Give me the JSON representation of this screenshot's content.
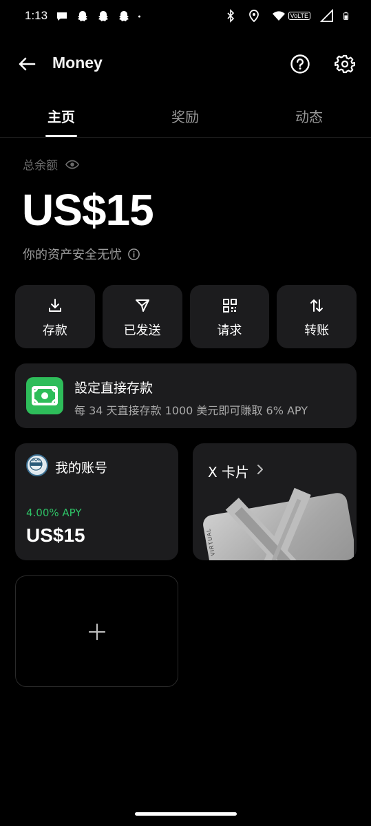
{
  "status_bar": {
    "time": "1:13",
    "left_icons": [
      "chat-icon",
      "snapchat-icon",
      "snapchat-icon",
      "snapchat-icon",
      "dot-icon"
    ],
    "right_icons": [
      "bluetooth-icon",
      "location-icon",
      "wifi-icon",
      "volte-icon",
      "signal-icon",
      "battery-icon"
    ],
    "volte_text": "VoLTE"
  },
  "header": {
    "title": "Money",
    "back_icon": "arrow-left-icon",
    "help_icon": "help-circle-icon",
    "settings_icon": "gear-icon"
  },
  "tabs": [
    {
      "label": "主页",
      "active": true
    },
    {
      "label": "奖励",
      "active": false
    },
    {
      "label": "动态",
      "active": false
    }
  ],
  "balance": {
    "label": "总余额",
    "amount": "US$15",
    "safe_text": "你的资产安全无忧",
    "eye_icon": "eye-icon",
    "info_icon": "info-icon"
  },
  "actions": [
    {
      "label": "存款",
      "icon": "download-icon"
    },
    {
      "label": "已发送",
      "icon": "send-icon"
    },
    {
      "label": "请求",
      "icon": "qr-code-icon"
    },
    {
      "label": "转账",
      "icon": "transfer-arrows-icon"
    }
  ],
  "promo": {
    "title": "設定直接存款",
    "subtitle": "每 34 天直接存款 1000 美元即可賺取 6% APY",
    "icon": "cash-icon",
    "icon_color": "#2ebd5a"
  },
  "account_card": {
    "title": "我的账号",
    "apy": "4.00% APY",
    "amount": "US$15",
    "avatar_icon": "denver-badge-avatar",
    "apy_color": "#2ec266"
  },
  "x_card": {
    "title": "X 卡片",
    "chevron_icon": "chevron-right-icon",
    "card_text": "VIRTUAL"
  },
  "add_card": {
    "icon": "plus-icon"
  }
}
